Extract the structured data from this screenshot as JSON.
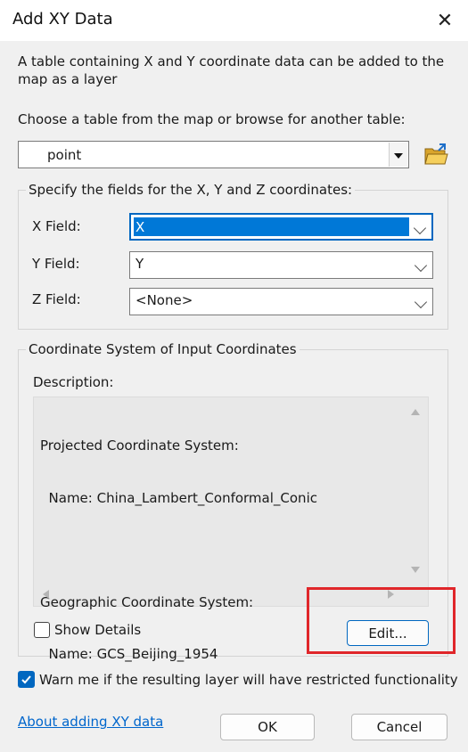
{
  "window": {
    "title": "Add XY Data"
  },
  "intro_text": "A table containing X and Y coordinate data can be added to the map as a layer",
  "table_prompt": "Choose a table from the map or browse for another table:",
  "table_select": {
    "value": "point"
  },
  "fields_group": {
    "title": "Specify the fields for the X, Y and Z coordinates:",
    "x_label": "X Field:",
    "x_value": "X",
    "y_label": "Y Field:",
    "y_value": "Y",
    "z_label": "Z Field:",
    "z_value": "<None>"
  },
  "coord_group": {
    "title": "Coordinate System of Input Coordinates",
    "description_label": "Description:",
    "lines": [
      "Projected Coordinate System:",
      "  Name: China_Lambert_Conformal_Conic",
      "",
      "Geographic Coordinate System:",
      "  Name: GCS_Beijing_1954"
    ],
    "show_details_label": "Show Details",
    "show_details_checked": false,
    "edit_button": "Edit..."
  },
  "warn_checkbox": {
    "label": "Warn me if the resulting layer will have restricted functionality",
    "checked": true
  },
  "about_link": "About adding XY data",
  "ok_button": "OK",
  "cancel_button": "Cancel",
  "colors": {
    "accent": "#0067c0",
    "selection": "#0078d7",
    "highlight_box": "#e0262a",
    "link": "#0066cc"
  },
  "icons": [
    "close-icon",
    "folder-open-icon",
    "chevron-down-icon",
    "scroll-up-icon",
    "scroll-down-icon",
    "scroll-left-icon",
    "scroll-right-icon",
    "checkmark-icon"
  ]
}
